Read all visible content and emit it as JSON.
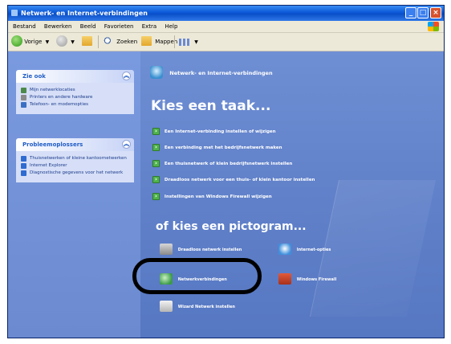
{
  "window": {
    "title": "Netwerk- en Internet-verbindingen"
  },
  "menubar": {
    "items": [
      "Bestand",
      "Bewerken",
      "Beeld",
      "Favorieten",
      "Extra",
      "Help"
    ]
  },
  "toolbar": {
    "back_label": "Vorige",
    "search_label": "Zoeken",
    "folders_label": "Mappen"
  },
  "sidebar": {
    "see_also": {
      "header": "Zie ook",
      "items": [
        "Mijn netwerklocaties",
        "Printers en andere hardware",
        "Telefoon- en modemopties"
      ]
    },
    "troubleshooters": {
      "header": "Probleemoplossers",
      "items": [
        "Thuisnetwerken of kleine kantoornetwerken",
        "Internet Explorer",
        "Diagnostische gegevens voor het netwerk"
      ]
    }
  },
  "main": {
    "category_label": "Netwerk- en Internet-verbindingen",
    "task_title": "Kies een taak...",
    "tasks": [
      "Een Internet-verbinding instellen of wijzigen",
      "Een verbinding met het bedrijfsnetwerk maken",
      "Een thuisnetwerk of klein bedrijfsnetwerk instellen",
      "Draadloos netwerk voor een thuis- of klein kantoor instellen",
      "Instellingen van Windows Firewall wijzigen"
    ],
    "icon_title": "of kies een pictogram...",
    "icons": [
      "Draadloos netwerk instellen",
      "Internet-opties",
      "Netwerkverbindingen",
      "Windows Firewall",
      "Wizard Netwerk instellen"
    ]
  }
}
